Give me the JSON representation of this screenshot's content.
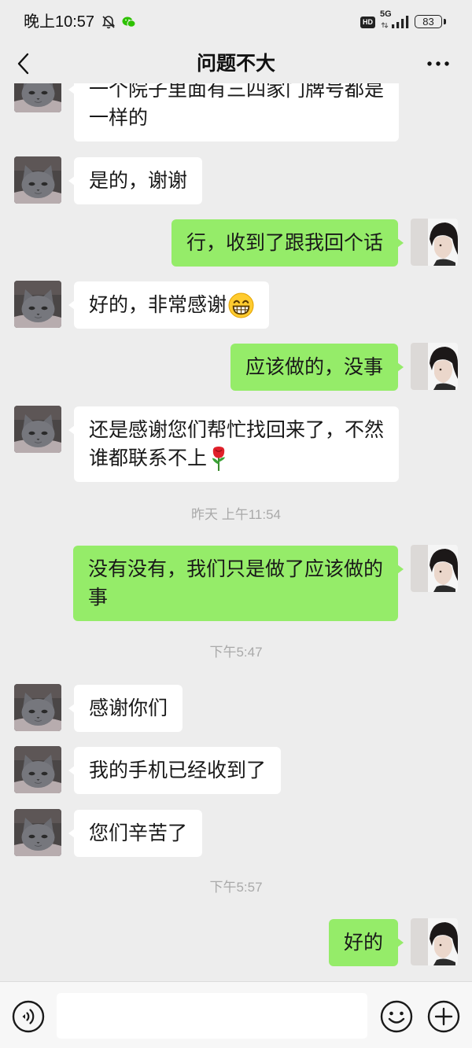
{
  "status_bar": {
    "time": "晚上10:57",
    "mute_icon": "bell-off-icon",
    "app_icon": "wechat-icon",
    "hd_label": "HD",
    "network": "5G",
    "signal_icon": "signal-icon",
    "battery_level": "83"
  },
  "header": {
    "back_icon": "chevron-left-icon",
    "title": "问题不大",
    "more_icon": "more-icon"
  },
  "avatars": {
    "contact": "gray-cat-avatar",
    "me": "portrait-avatar"
  },
  "colors": {
    "background": "#ededed",
    "incoming_bubble": "#ffffff",
    "outgoing_bubble": "#95ec69",
    "text": "#191919",
    "timestamp": "#a9a9a9"
  },
  "chat": [
    {
      "from_me": false,
      "lines": [
        "一个院子里面有三四家门牌号都是",
        "一样的"
      ]
    },
    {
      "from_me": false,
      "lines": [
        "是的，谢谢"
      ]
    },
    {
      "from_me": true,
      "lines": [
        "行，收到了跟我回个话"
      ]
    },
    {
      "from_me": false,
      "lines": [
        "好的，非常感谢"
      ],
      "emoji_icon": "grinning-face-emoji"
    },
    {
      "from_me": true,
      "lines": [
        "应该做的，没事"
      ]
    },
    {
      "from_me": false,
      "lines": [
        "还是感谢您们帮忙找回来了，不然",
        "谁都联系不上"
      ],
      "emoji_icon": "rose-emoji"
    },
    {
      "timestamp": "昨天 上午11:54"
    },
    {
      "from_me": true,
      "lines": [
        "没有没有，我们只是做了应该做的",
        "事"
      ]
    },
    {
      "timestamp": "下午5:47"
    },
    {
      "from_me": false,
      "lines": [
        "感谢你们"
      ]
    },
    {
      "from_me": false,
      "lines": [
        "我的手机已经收到了"
      ]
    },
    {
      "from_me": false,
      "lines": [
        "您们辛苦了"
      ]
    },
    {
      "timestamp": "下午5:57"
    },
    {
      "from_me": true,
      "lines": [
        "好的"
      ]
    }
  ],
  "input_bar": {
    "voice_icon": "voice-icon",
    "message_value": "",
    "emoji_icon": "emoji-icon",
    "plus_icon": "plus-icon"
  }
}
